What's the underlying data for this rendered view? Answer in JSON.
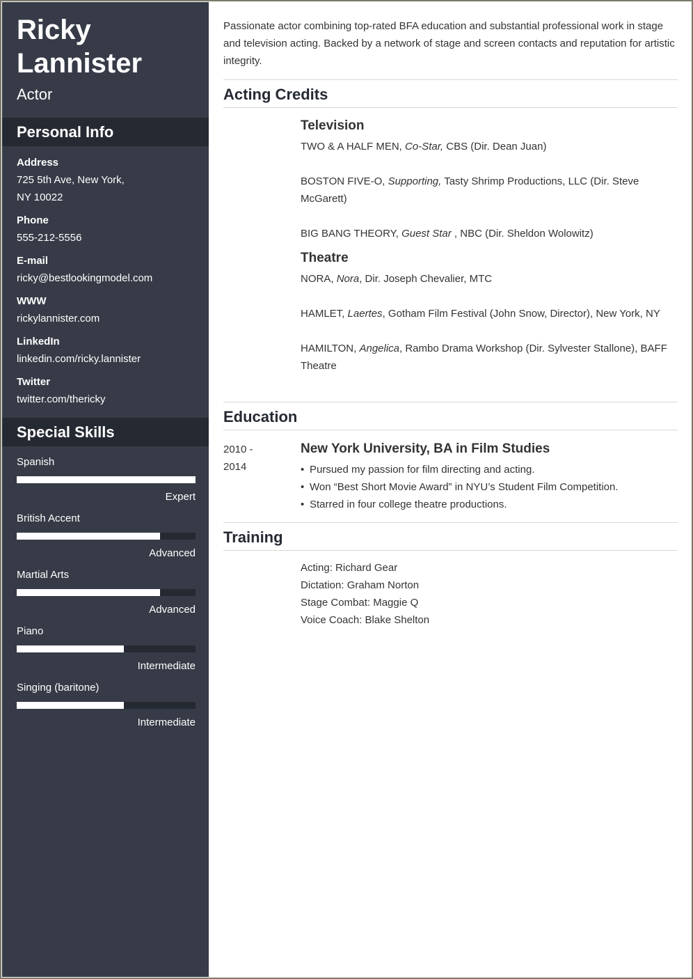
{
  "header": {
    "first_name": "Ricky",
    "last_name": "Lannister",
    "job_title": "Actor"
  },
  "personal_info": {
    "heading": "Personal Info",
    "items": [
      {
        "label": "Address",
        "value_lines": [
          "725 5th Ave, New York,",
          "NY 10022"
        ]
      },
      {
        "label": "Phone",
        "value_lines": [
          "555-212-5556"
        ]
      },
      {
        "label": "E-mail",
        "value_lines": [
          "ricky@bestlookingmodel.com"
        ]
      },
      {
        "label": "WWW",
        "value_lines": [
          "rickylannister.com"
        ]
      },
      {
        "label": "LinkedIn",
        "value_lines": [
          "linkedin.com/ricky.lannister"
        ]
      },
      {
        "label": "Twitter",
        "value_lines": [
          "twitter.com/thericky"
        ]
      }
    ]
  },
  "skills": {
    "heading": "Special Skills",
    "items": [
      {
        "name": "Spanish",
        "level": "Expert",
        "fill_percent": 100
      },
      {
        "name": "British Accent",
        "level": "Advanced",
        "fill_percent": 80
      },
      {
        "name": "Martial Arts",
        "level": "Advanced",
        "fill_percent": 80
      },
      {
        "name": "Piano",
        "level": "Intermediate",
        "fill_percent": 60
      },
      {
        "name": "Singing (baritone)",
        "level": "Intermediate",
        "fill_percent": 60
      }
    ]
  },
  "summary": "Passionate actor combining top-rated BFA education and substantial professional work in stage and television acting. Backed by a network of stage and screen contacts and reputation for artistic integrity.",
  "acting_credits": {
    "heading": "Acting Credits",
    "television": {
      "heading": "Television",
      "credits": [
        {
          "title": "TWO & A HALF MEN, ",
          "role": "Co-Star,",
          "rest": " CBS (Dir. Dean Juan)"
        },
        {
          "title": "BOSTON FIVE-O, ",
          "role": "Supporting,",
          "rest": " Tasty Shrimp Productions, LLC (Dir. Steve McGarett)"
        },
        {
          "title": "BIG BANG THEORY, ",
          "role": "Guest Star",
          "rest": " , NBC (Dir. Sheldon Wolowitz)"
        }
      ]
    },
    "theatre": {
      "heading": "Theatre",
      "credits": [
        {
          "title": "NORA, ",
          "role": "Nora",
          "rest": ", Dir. Joseph Chevalier, MTC"
        },
        {
          "title": "HAMLET, ",
          "role": "Laertes",
          "rest": ", Gotham Film Festival (John Snow, Director), New York, NY"
        },
        {
          "title": "HAMILTON, ",
          "role": "Angelica",
          "rest": ", Rambo Drama Workshop (Dir. Sylvester Stallone), BAFF Theatre"
        }
      ]
    }
  },
  "education": {
    "heading": "Education",
    "date_start": "2010 -",
    "date_end": "2014",
    "degree": "New York University, BA in Film Studies",
    "bullets": [
      "Pursued my passion for film directing and acting.",
      "Won “Best Short Movie Award” in NYU’s Student Film Competition.",
      "Starred in four college theatre productions."
    ]
  },
  "training": {
    "heading": "Training",
    "items": [
      "Acting: Richard Gear",
      "Dictation: Graham Norton",
      "Stage Combat: Maggie Q",
      "Voice Coach: Blake Shelton"
    ]
  }
}
